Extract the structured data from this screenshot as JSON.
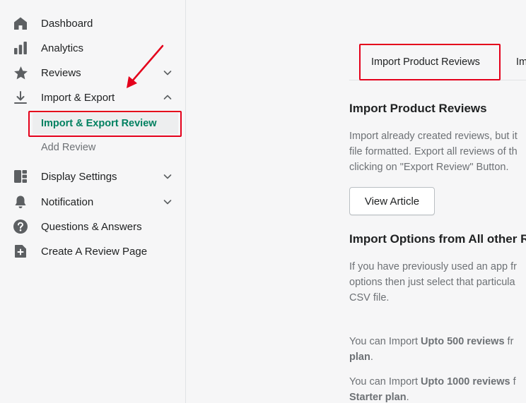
{
  "sidebar": {
    "items": [
      {
        "label": "Dashboard"
      },
      {
        "label": "Analytics"
      },
      {
        "label": "Reviews"
      },
      {
        "label": "Import & Export"
      },
      {
        "label": "Display Settings"
      },
      {
        "label": "Notification"
      },
      {
        "label": "Questions & Answers"
      },
      {
        "label": "Create A Review Page"
      }
    ],
    "sub_items": [
      {
        "label": "Import & Export Review"
      },
      {
        "label": "Add Review"
      }
    ]
  },
  "main": {
    "tabs": [
      {
        "label": "Import Product Reviews"
      },
      {
        "label": "Im"
      }
    ],
    "section1": {
      "heading": "Import Product Reviews",
      "lines": [
        "Import already created reviews, but it",
        "file formatted. Export all reviews of th",
        "clicking on \"Export Review\" Button."
      ],
      "button_label": "View Article"
    },
    "section2": {
      "heading": "Import Options from All other R",
      "lines": [
        "If you have previously used an app fr",
        "options then just select that particula",
        "CSV file."
      ]
    },
    "plans": {
      "p1_prefix": "You can Import ",
      "p1_bold": "Upto 500 reviews",
      "p1_suffix": " fr",
      "p1_line2": "plan",
      "p2_prefix": "You can Import ",
      "p2_bold": "Upto 1000 reviews",
      "p2_suffix": " f",
      "p2_line2": "Starter plan"
    }
  },
  "colors": {
    "accent": "#008060",
    "highlight": "#e4001b",
    "sidebar_bg": "#f6f6f7"
  }
}
